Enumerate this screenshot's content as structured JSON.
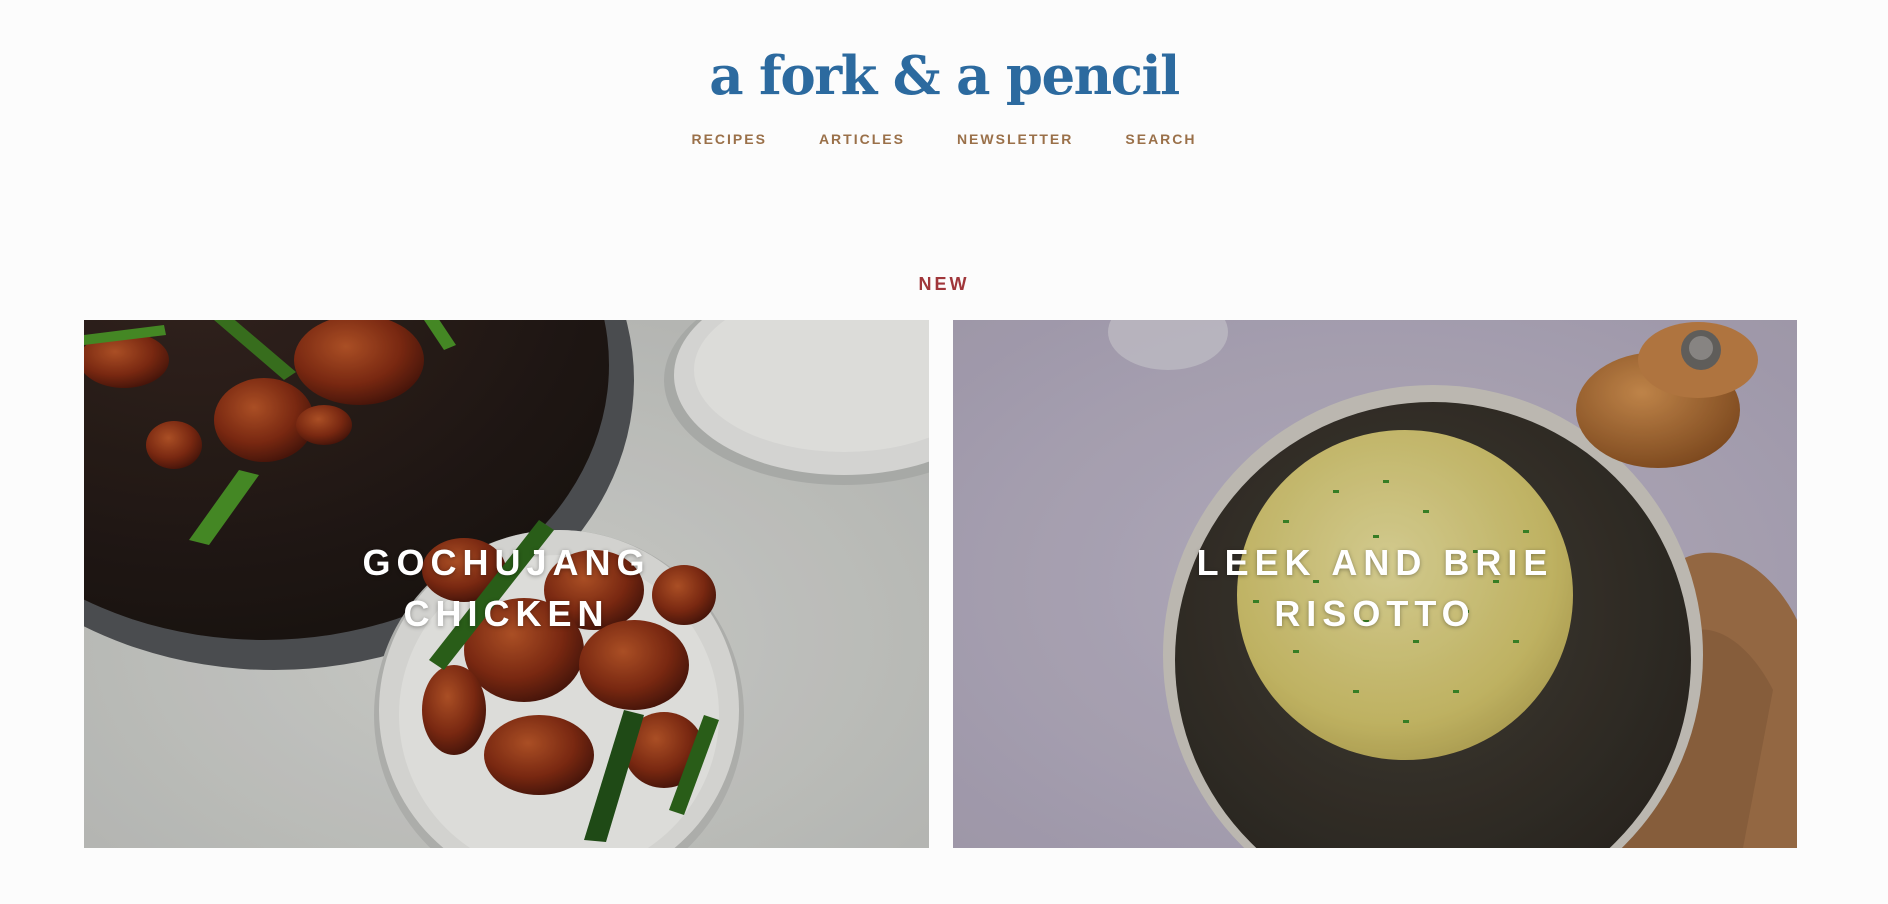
{
  "site": {
    "logo_text": "a fork & a pencil"
  },
  "nav": {
    "items": [
      {
        "label": "RECIPES"
      },
      {
        "label": "ARTICLES"
      },
      {
        "label": "NEWSLETTER"
      },
      {
        "label": "SEARCH"
      }
    ]
  },
  "section": {
    "label": "NEW"
  },
  "cards": [
    {
      "title_line1": "GOCHUJANG",
      "title_line2": "CHICKEN"
    },
    {
      "title_line1": "LEEK AND BRIE",
      "title_line2": "RISOTTO"
    }
  ],
  "colors": {
    "background": "#fcfcfc",
    "logo": "#2c6a9f",
    "nav": "#9a7049",
    "section_label": "#a0363a",
    "card_title": "#ffffff"
  },
  "icons": {
    "card_1_image": "gochujang-chicken-photo",
    "card_2_image": "leek-brie-risotto-photo"
  }
}
